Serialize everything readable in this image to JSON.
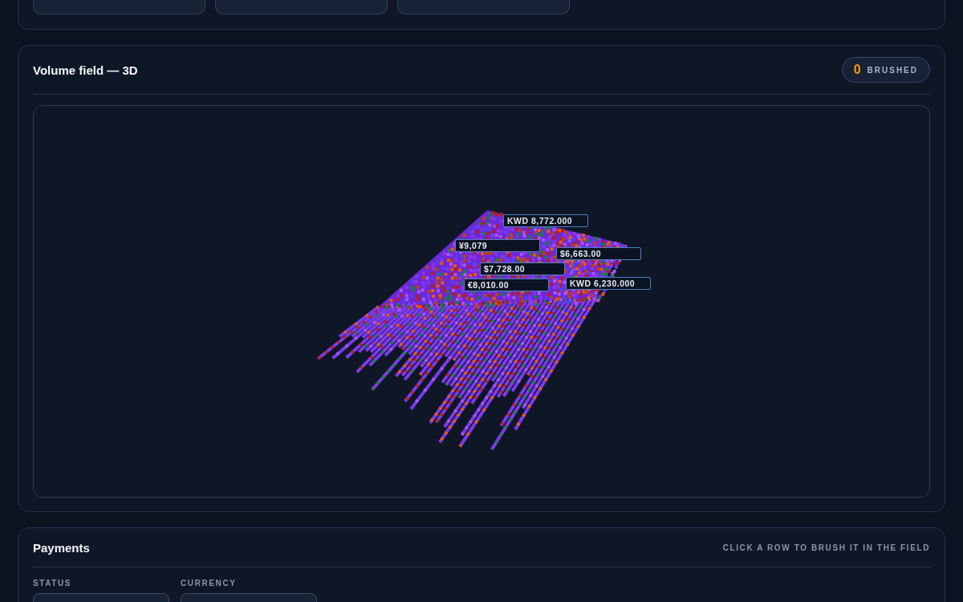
{
  "volume_panel": {
    "title": "Volume field — 3D",
    "brushed": {
      "count": "0",
      "label": "BRUSHED"
    },
    "labels": [
      {
        "text": "KWD 8,772.000"
      },
      {
        "text": "¥9,079"
      },
      {
        "text": "$6,663.00"
      },
      {
        "text": "$7,728.00"
      },
      {
        "text": "€8,010.00"
      },
      {
        "text": "KWD 6,230.000"
      }
    ]
  },
  "payments": {
    "title": "Payments",
    "hint": "CLICK A ROW TO BRUSH IT IN THE FIELD",
    "filters": [
      {
        "label": "STATUS"
      },
      {
        "label": "CURRENCY"
      }
    ]
  }
}
